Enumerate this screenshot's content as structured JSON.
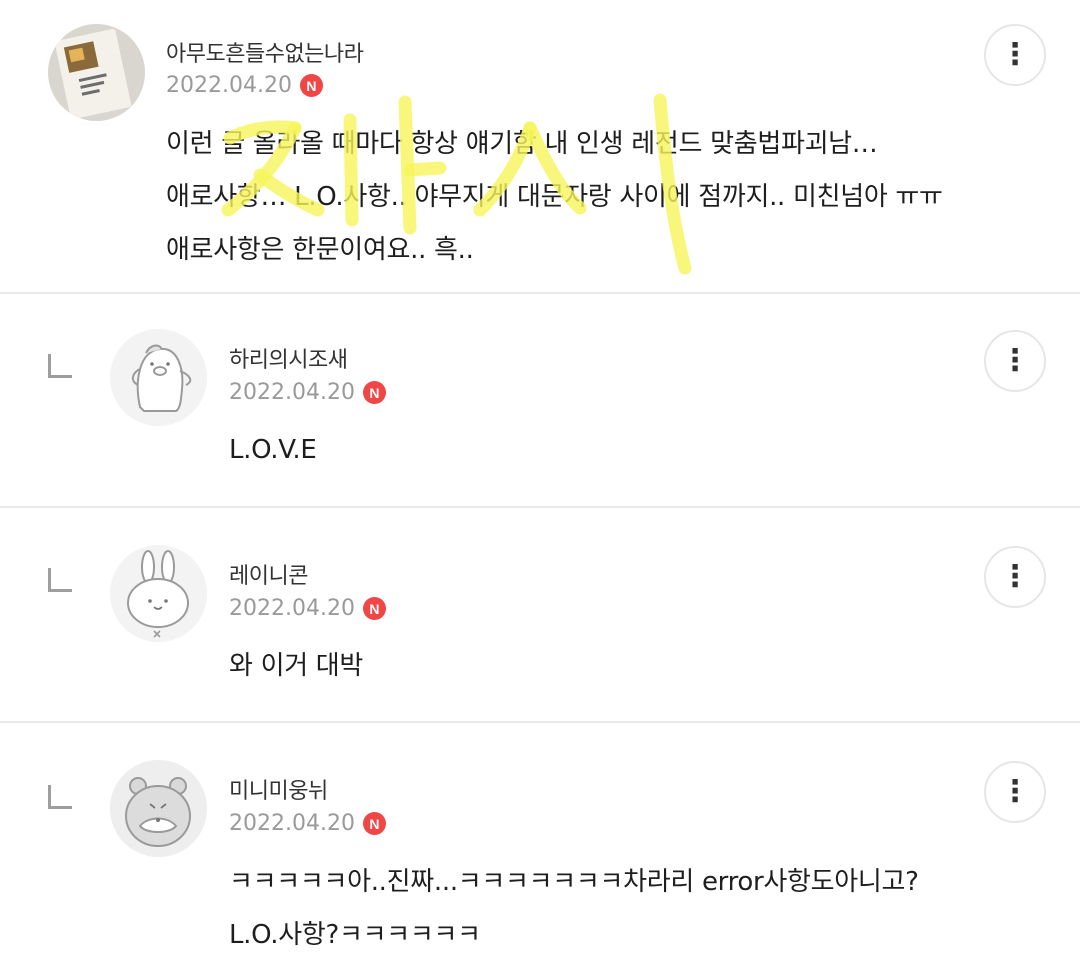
{
  "comments": [
    {
      "nickname": "아무도흔들수없는나라",
      "date": "2022.04.20",
      "badge": "N",
      "lines": [
        "이런 글 올라올 때마다 항상 얘기함 내 인생 레전드 맞춤법파괴남…",
        "애로사항… L.O.사항.. 야무지게 대문자랑 사이에 점까지.. 미친넘아 ㅠㅠ",
        "애로사항은 한문이여요.. 흑.."
      ],
      "avatar_icon": "book-photo-avatar"
    },
    {
      "nickname": "하리의시조새",
      "date": "2022.04.20",
      "badge": "N",
      "lines": [
        "L.O.V.E"
      ],
      "avatar_icon": "penguin-avatar"
    },
    {
      "nickname": "레이니콘",
      "date": "2022.04.20",
      "badge": "N",
      "lines": [
        "와 이거 대박"
      ],
      "avatar_icon": "rabbit-avatar"
    },
    {
      "nickname": "미니미웅뉘",
      "date": "2022.04.20",
      "badge": "N",
      "lines": [
        "ㅋㅋㅋㅋㅋ아..진짜...ㅋㅋㅋㅋㅋㅋㅋ차라리 error사항도아니고?",
        "L.O.사항?ㅋㅋㅋㅋㅋㅋ"
      ],
      "avatar_icon": "bear-avatar"
    }
  ],
  "more_glyph": "⋮",
  "colors": {
    "badge": "#f04646",
    "divider": "#e9e9e9",
    "date": "#9a9a9a",
    "highlight_scribble": "#f6f55a"
  }
}
